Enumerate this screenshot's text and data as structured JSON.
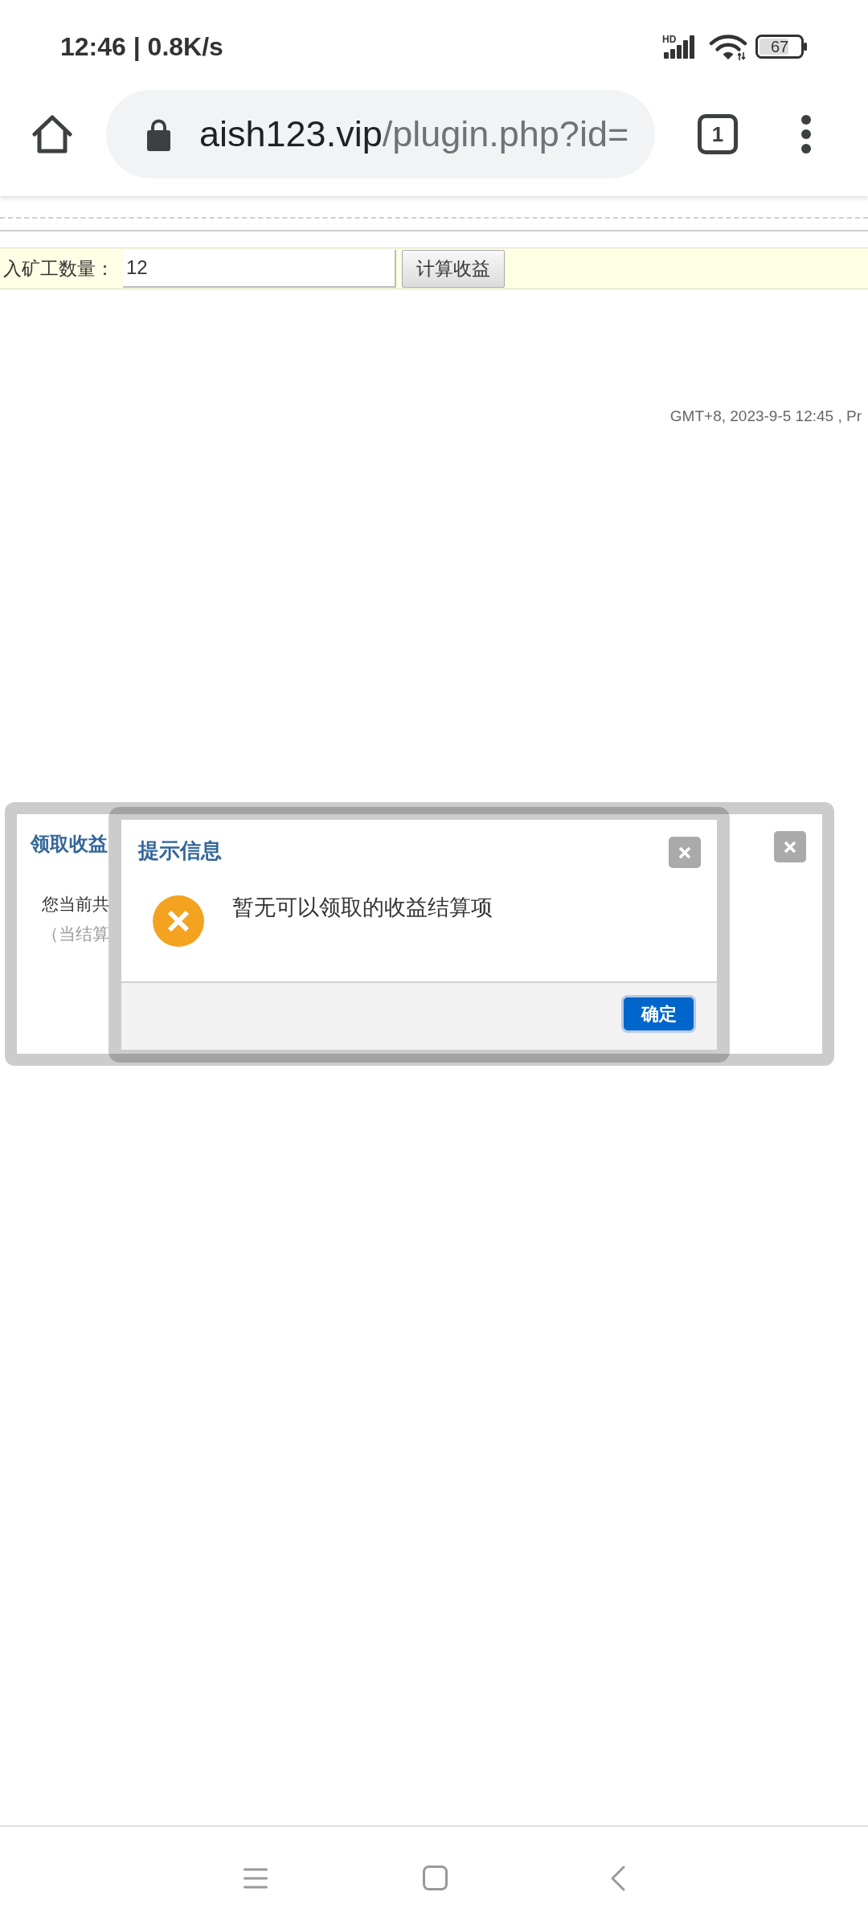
{
  "status_bar": {
    "time": "12:46 | 0.8K/s",
    "network_badge": "HD",
    "battery": "67"
  },
  "browser_toolbar": {
    "url_domain": "aish123.vip",
    "url_path": "/plugin.php?id=",
    "tab_count": "1"
  },
  "page": {
    "calc_row": {
      "label": "入矿工数量：",
      "input_value": "12",
      "button": "计算收益"
    },
    "footer_text": "GMT+8, 2023-9-5 12:45 , Pr"
  },
  "background_dialog": {
    "title": "领取收益",
    "lines": [
      {
        "text": "您当前共",
        "kind": "primary"
      },
      {
        "text": "（当结算",
        "kind": "note"
      }
    ]
  },
  "alert_dialog": {
    "title": "提示信息",
    "kind": "error",
    "message": "暂无可以领取的收益结算项",
    "confirm_button": {
      "label": "确定",
      "focused": true
    }
  }
}
